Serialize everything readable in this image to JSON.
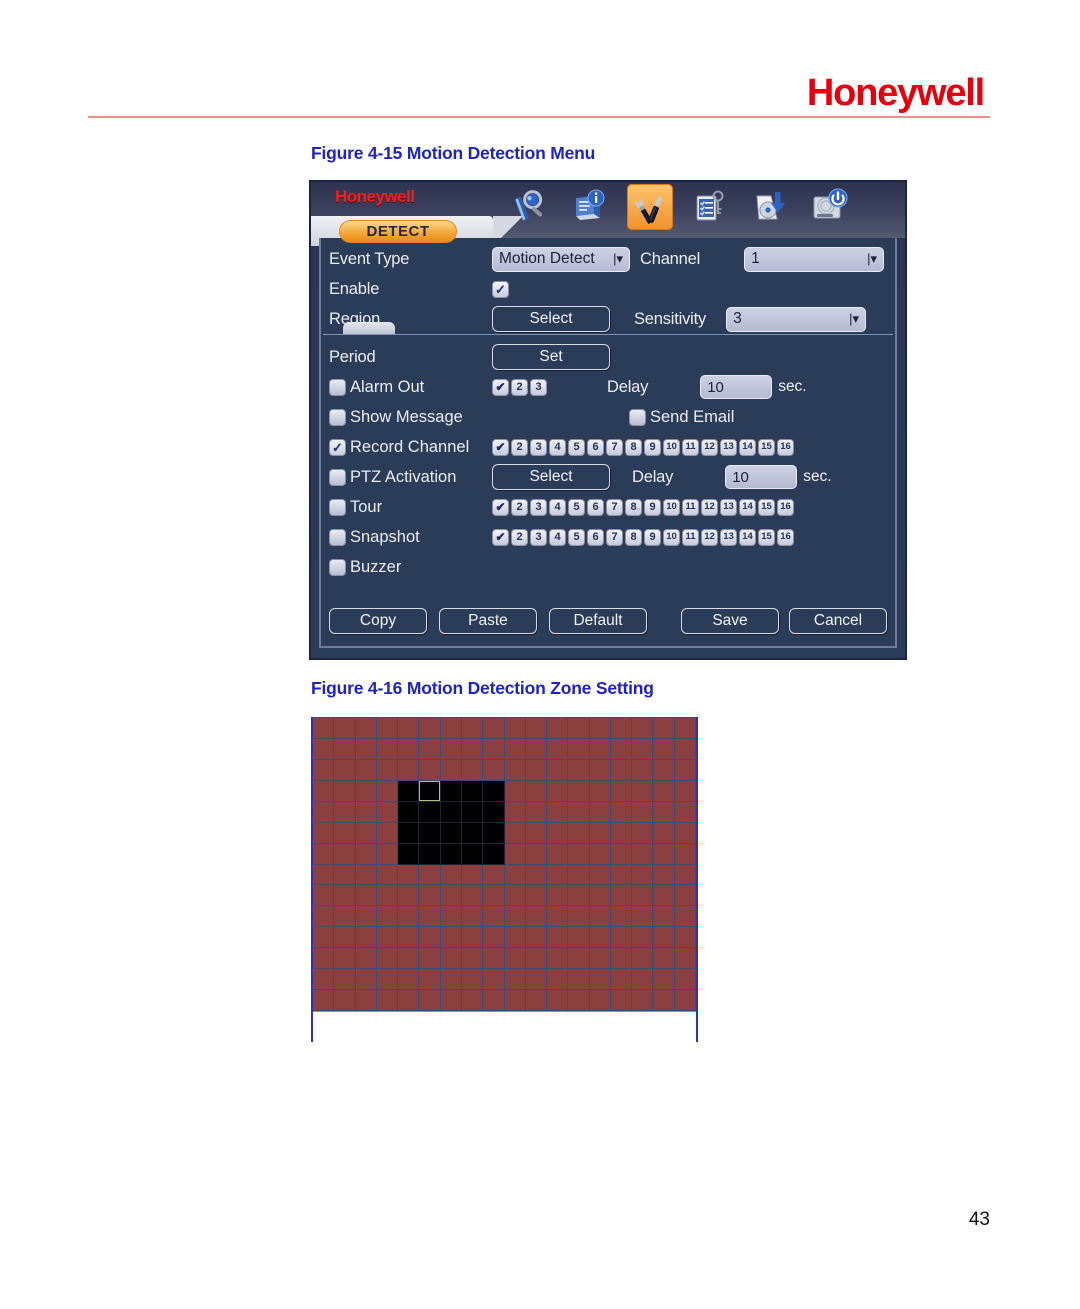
{
  "document": {
    "brand": "Honeywell",
    "page_number": "43",
    "figures": [
      {
        "id": "fig-4-15",
        "caption": "Figure 4-15 Motion Detection Menu"
      },
      {
        "id": "fig-4-16",
        "caption": "Figure 4-16 Motion Detection Zone Setting"
      }
    ]
  },
  "dvr": {
    "logo": "Honeywell",
    "active_tab": "DETECT",
    "toolbar": [
      {
        "name": "search-icon",
        "label": "Search",
        "active": false
      },
      {
        "name": "info-icon",
        "label": "Info",
        "active": false
      },
      {
        "name": "settings-icon",
        "label": "Setting",
        "active": true
      },
      {
        "name": "account-icon",
        "label": "Advanced",
        "active": false
      },
      {
        "name": "backup-icon",
        "label": "Backup",
        "active": false
      },
      {
        "name": "shutdown-icon",
        "label": "Shutdown",
        "active": false
      }
    ],
    "fields": {
      "event_type_label": "Event Type",
      "event_type_value": "Motion Detect",
      "channel_label": "Channel",
      "channel_value": "1",
      "enable_label": "Enable",
      "enable_checked": "✓",
      "region_label": "Region",
      "region_button": "Select",
      "sensitivity_label": "Sensitivity",
      "sensitivity_value": "3",
      "period_label": "Period",
      "period_button": "Set",
      "alarm_out_label": "Alarm Out",
      "alarm_out_delay_label": "Delay",
      "alarm_out_delay_value": "10",
      "alarm_out_delay_unit": "sec.",
      "show_message_label": "Show Message",
      "send_email_label": "Send Email",
      "record_channel_label": "Record Channel",
      "ptz_activation_label": "PTZ Activation",
      "ptz_button": "Select",
      "ptz_delay_label": "Delay",
      "ptz_delay_value": "10",
      "ptz_delay_unit": "sec.",
      "tour_label": "Tour",
      "snapshot_label": "Snapshot",
      "buzzer_label": "Buzzer",
      "checked_glyph": "✔"
    },
    "toggles": {
      "alarm_out": false,
      "show_message": false,
      "send_email": false,
      "record_channel": true,
      "ptz_activation": false,
      "tour": false,
      "snapshot": false,
      "buzzer": false
    },
    "channel_chips": {
      "alarm_out": [
        "1",
        "2",
        "3"
      ],
      "alarm_out_checked": [
        1
      ],
      "record_channel": [
        "1",
        "2",
        "3",
        "4",
        "5",
        "6",
        "7",
        "8",
        "9",
        "10",
        "11",
        "12",
        "13",
        "14",
        "15",
        "16"
      ],
      "record_channel_checked": [
        1
      ],
      "tour": [
        "1",
        "2",
        "3",
        "4",
        "5",
        "6",
        "7",
        "8",
        "9",
        "10",
        "11",
        "12",
        "13",
        "14",
        "15",
        "16"
      ],
      "tour_checked": [
        1
      ],
      "snapshot": [
        "1",
        "2",
        "3",
        "4",
        "5",
        "6",
        "7",
        "8",
        "9",
        "10",
        "11",
        "12",
        "13",
        "14",
        "15",
        "16"
      ],
      "snapshot_checked": [
        1
      ]
    },
    "buttons": {
      "copy": "Copy",
      "paste": "Paste",
      "default": "Default",
      "save": "Save",
      "cancel": "Cancel"
    }
  },
  "zone": {
    "columns": 18,
    "rows": 14,
    "active_color": "#8b3f3f",
    "cleared_color": "#000000",
    "grid_line_color": "#3d4a72",
    "cursor_cell": {
      "col": 6,
      "row": 4
    },
    "cleared_region": {
      "col_start": 5,
      "col_end": 9,
      "row_start": 4,
      "row_end": 7
    }
  }
}
